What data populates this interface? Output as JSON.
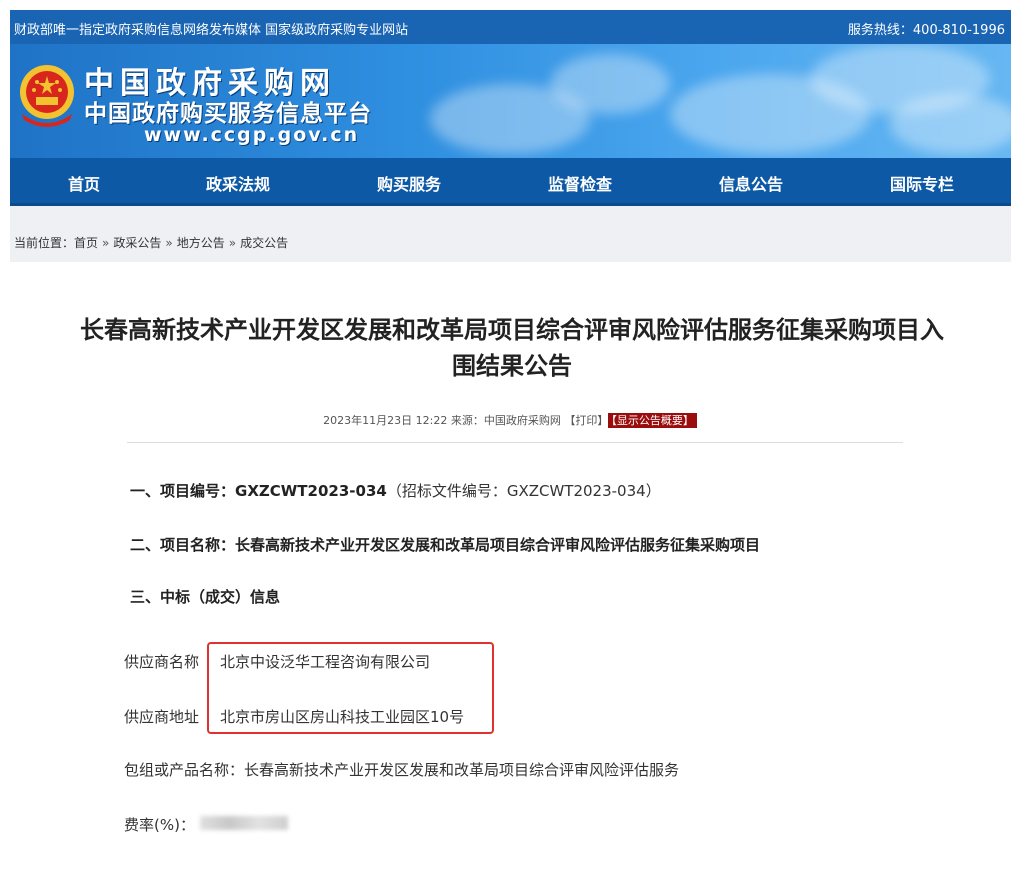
{
  "topbar": {
    "left_text": "财政部唯一指定政府采购信息网络发布媒体 国家级政府采购专业网站",
    "hotline": "服务热线：400-810-1996"
  },
  "banner": {
    "logo_line1": "中国政府采购网",
    "logo_line2": "中国政府购买服务信息平台",
    "logo_url": "www.ccgp.gov.cn",
    "emblem_icon": "national-emblem-icon"
  },
  "nav": {
    "items": [
      "首页",
      "政采法规",
      "购买服务",
      "监督检查",
      "信息公告",
      "国际专栏"
    ]
  },
  "breadcrumb": {
    "prefix": "当前位置：",
    "items": [
      "首页",
      "政采公告",
      "地方公告",
      "成交公告"
    ],
    "separator": "»"
  },
  "article": {
    "title_line1": "长春高新技术产业开发区发展和改革局项目综合评审风险评估服务征集采购项目入",
    "title_line2": "围结果公告",
    "meta_info": "2023年11月23日 12:22 来源：中国政府采购网 【打印】",
    "meta_tag": "【显示公告概要】",
    "sections": {
      "s1_label": "一、项目编号：GXZCWT2023-034",
      "s1_extra": "（招标文件编号：GXZCWT2023-034）",
      "s2": "二、项目名称：长春高新技术产业开发区发展和改革局项目综合评审风险评估服务征集采购项目",
      "s3": "三、中标（成交）信息"
    }
  },
  "supplier": {
    "name_label": "供应商名称",
    "name_value": "北京中设泛华工程咨询有限公司",
    "addr_label": "供应商地址",
    "addr_value": "北京市房山区房山科技工业园区10号",
    "package_label": "包组或产品名称：",
    "package_value": "长春高新技术产业开发区发展和改革局项目综合评审风险评估服务",
    "rate_label": "费率(%)："
  },
  "colors": {
    "topbar": "#1a64b4",
    "nav": "#0d59a6",
    "highlight_box": "#e03030",
    "meta_tag": "#9b0c0c"
  }
}
